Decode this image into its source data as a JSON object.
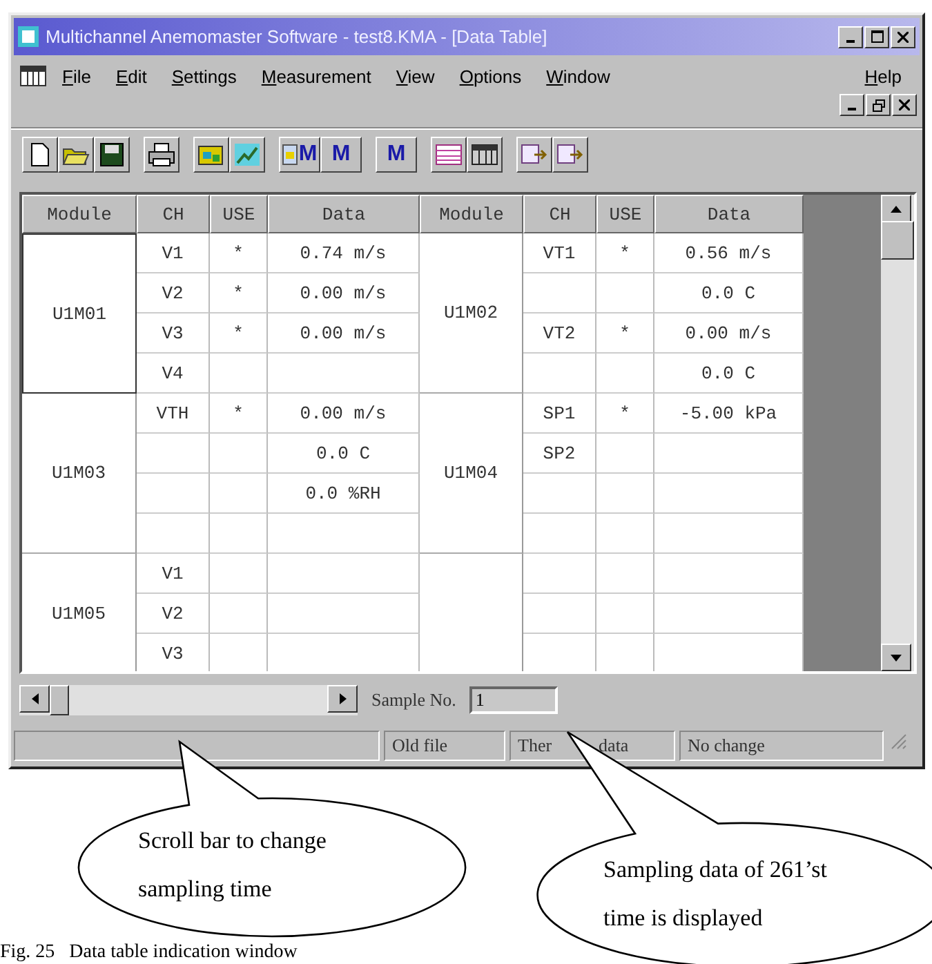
{
  "window": {
    "title": "Multichannel Anemomaster Software - test8.KMA - [Data Table]"
  },
  "menu": [
    {
      "label": "File"
    },
    {
      "label": "Edit"
    },
    {
      "label": "Settings"
    },
    {
      "label": "Measurement"
    },
    {
      "label": "View"
    },
    {
      "label": "Options"
    },
    {
      "label": "Window"
    },
    {
      "label": "Help"
    }
  ],
  "toolbar": [
    [
      {
        "kind": "new"
      },
      {
        "kind": "open"
      },
      {
        "kind": "save"
      }
    ],
    [
      {
        "kind": "print"
      }
    ],
    [
      {
        "kind": "folder-chart"
      },
      {
        "kind": "chart"
      }
    ],
    [
      {
        "kind": "grid-m",
        "label": "M"
      },
      {
        "kind": "m",
        "label": "M"
      }
    ],
    [
      {
        "kind": "m",
        "label": "M"
      }
    ],
    [
      {
        "kind": "table"
      },
      {
        "kind": "table-dark"
      }
    ],
    [
      {
        "kind": "copy"
      },
      {
        "kind": "copy"
      }
    ]
  ],
  "table": {
    "columns": [
      "Module",
      "CH",
      "USE",
      "Data",
      "Module",
      "CH",
      "USE",
      "Data"
    ],
    "left": [
      {
        "module": "U1M01",
        "rows": [
          {
            "ch": "V1",
            "use": "*",
            "data": "0.74 m/s"
          },
          {
            "ch": "V2",
            "use": "*",
            "data": "0.00 m/s"
          },
          {
            "ch": "V3",
            "use": "*",
            "data": "0.00 m/s"
          },
          {
            "ch": "V4"
          }
        ]
      },
      {
        "module": "U1M03",
        "rows": [
          {
            "ch": "VTH",
            "use": "*",
            "data": "0.00 m/s"
          },
          {
            "data": "0.0 C"
          },
          {
            "data": "0.0 %RH"
          },
          {}
        ]
      },
      {
        "module": "U1M05",
        "rows": [
          {
            "ch": "V1"
          },
          {
            "ch": "V2"
          },
          {
            "ch": "V3"
          }
        ]
      }
    ],
    "right": [
      {
        "module": "U1M02",
        "rows": [
          {
            "ch": "VT1",
            "use": "*",
            "data": "0.56 m/s"
          },
          {
            "data": "0.0 C"
          },
          {
            "ch": "VT2",
            "use": "*",
            "data": "0.00 m/s"
          },
          {
            "data": "0.0 C"
          }
        ]
      },
      {
        "module": "U1M04",
        "rows": [
          {
            "ch": "SP1",
            "use": "*",
            "data": "-5.00 kPa"
          },
          {
            "ch": "SP2"
          },
          {},
          {}
        ]
      },
      {
        "rows": [
          {},
          {},
          {}
        ]
      }
    ]
  },
  "sample": {
    "label": "Sample No.",
    "value": "1"
  },
  "status_bar": [
    {
      "texts": [
        "Old file"
      ]
    },
    {
      "texts": [
        "Ther",
        "data"
      ]
    },
    {
      "texts": [
        "No change"
      ]
    }
  ],
  "callouts": [
    {
      "text": "Scroll bar to change sampling time"
    },
    {
      "text": "Sampling data of 261’st time is displayed"
    }
  ],
  "caption": "Fig. 25   Data table indication window"
}
